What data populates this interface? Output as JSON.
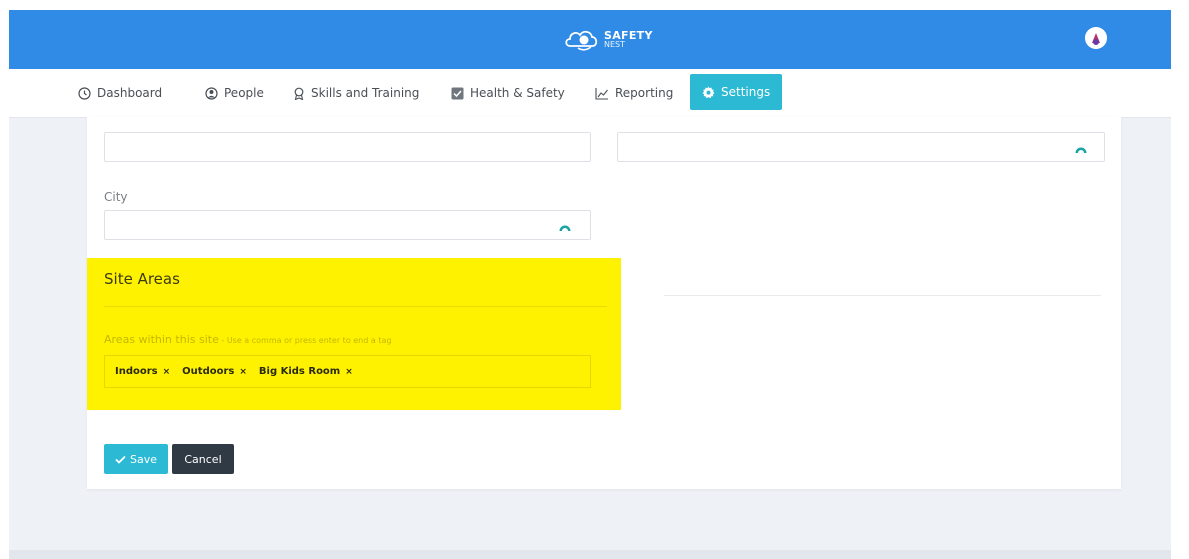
{
  "brand": {
    "line1": "SAFETY",
    "line2": "NEST"
  },
  "nav": {
    "items": [
      {
        "label": "Dashboard"
      },
      {
        "label": "People"
      },
      {
        "label": "Skills and Training"
      },
      {
        "label": "Health & Safety"
      },
      {
        "label": "Reporting"
      },
      {
        "label": "Settings",
        "active": true
      }
    ]
  },
  "form": {
    "city_label": "City",
    "site_areas_title": "Site Areas",
    "areas_label": "Areas within this site",
    "areas_hint": " - Use a comma or press enter to end a tag",
    "tags": [
      "Indoors",
      "Outdoors",
      "Big Kids Room"
    ],
    "tag_remove": "×"
  },
  "buttons": {
    "save": "Save",
    "cancel": "Cancel"
  },
  "colors": {
    "header": "#2f8be6",
    "accent": "#2bb9d4",
    "highlight": "#fff200",
    "dark_button": "#2f3a45"
  }
}
